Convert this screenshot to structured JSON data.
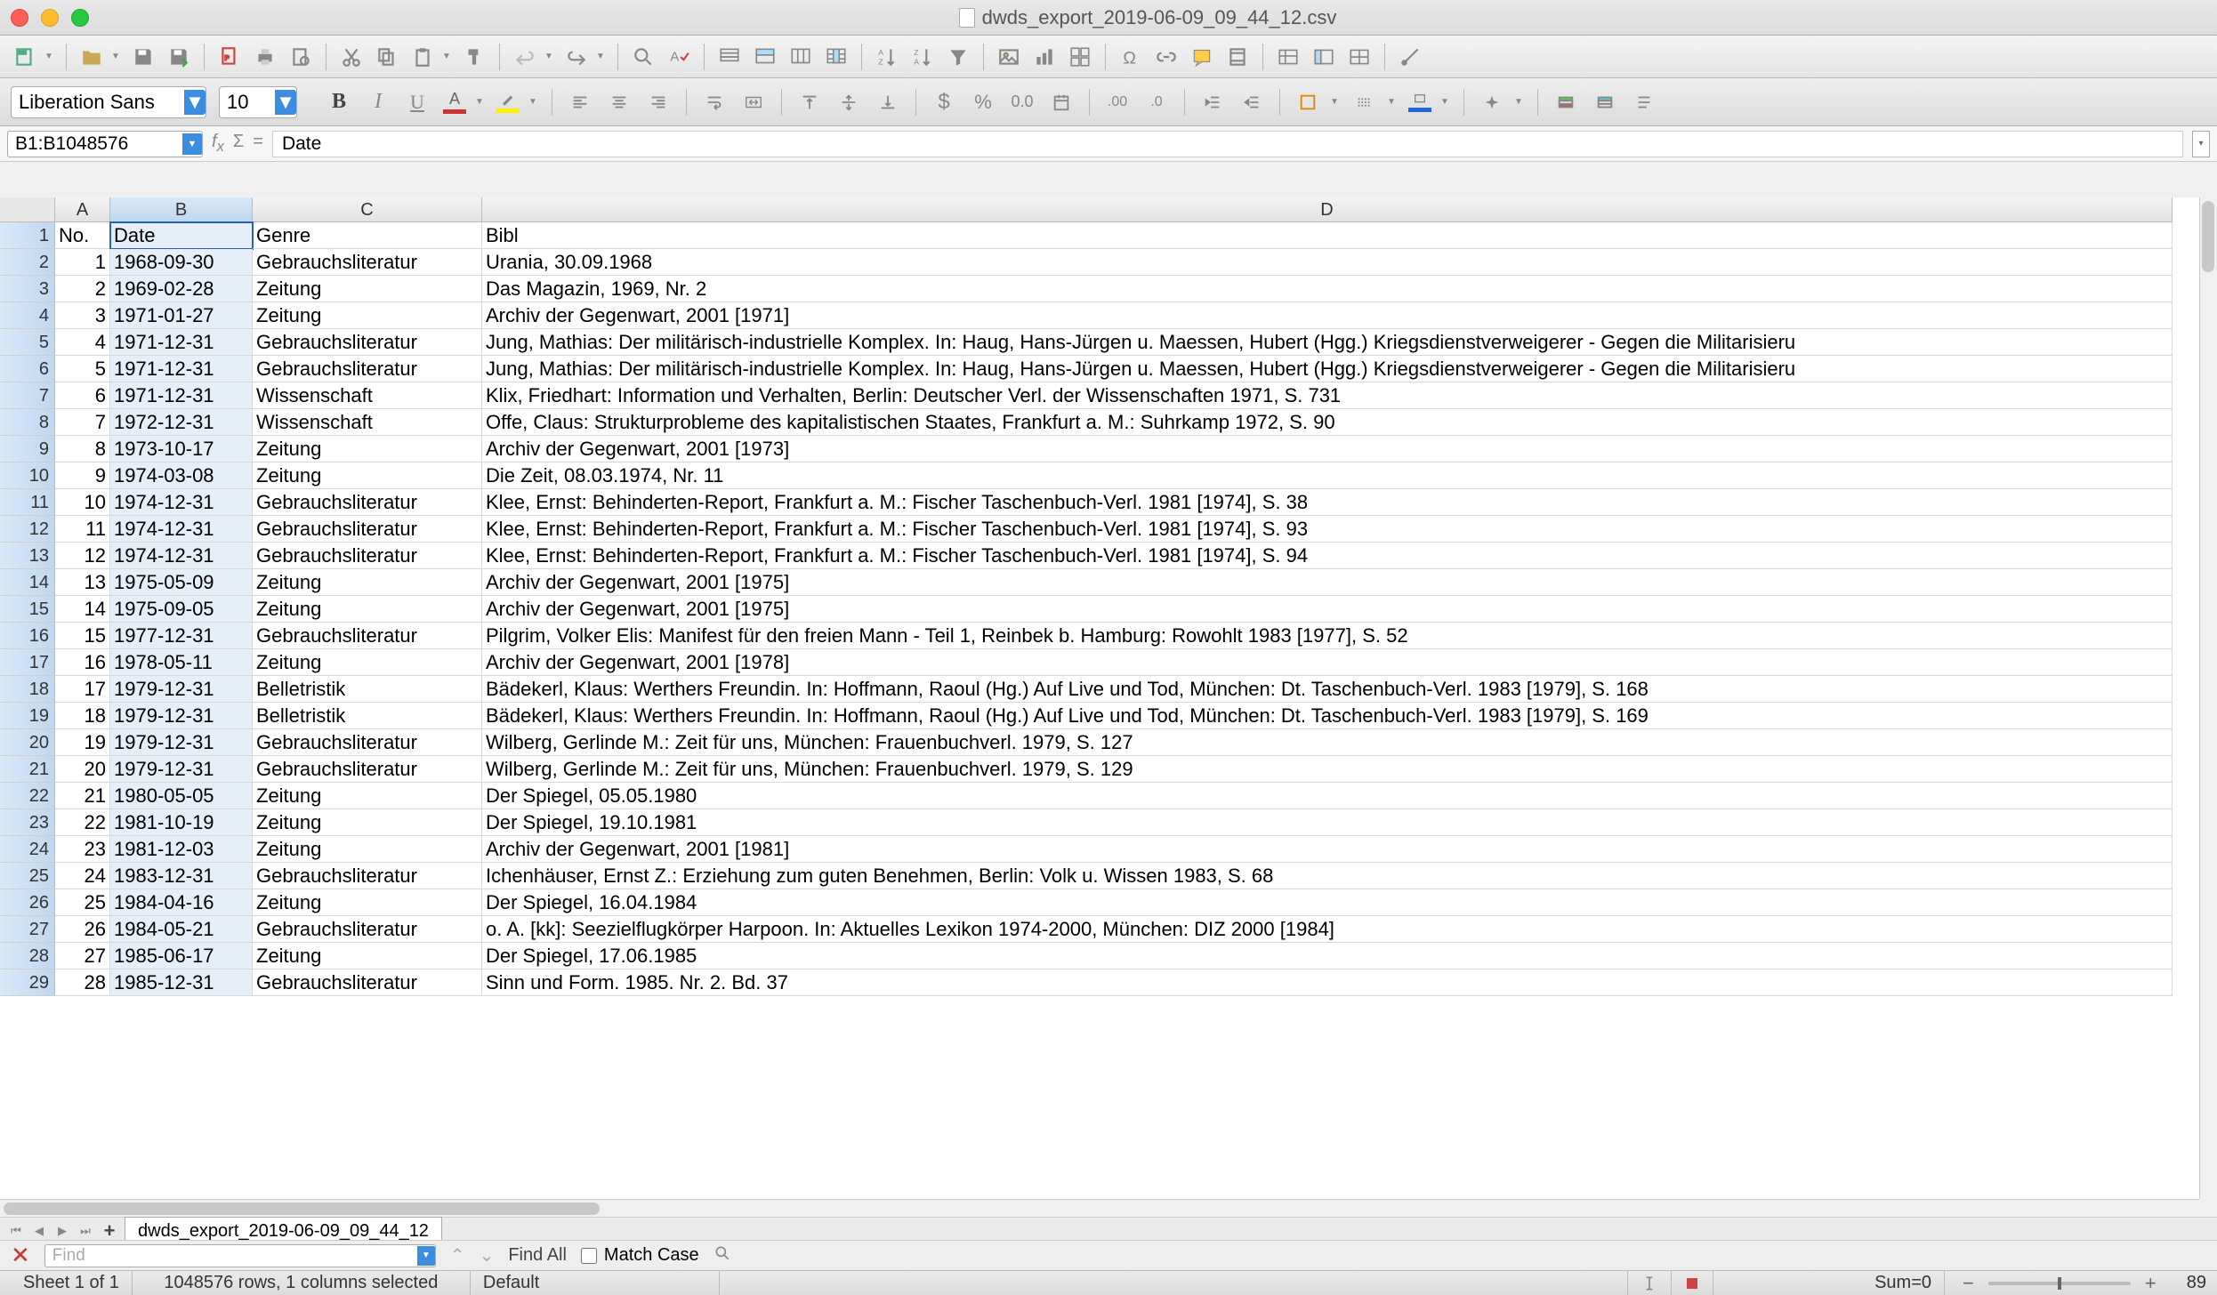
{
  "window": {
    "title": "dwds_export_2019-06-09_09_44_12.csv"
  },
  "font": {
    "name": "Liberation Sans",
    "size": "10"
  },
  "name_box": "B1:B1048576",
  "formula_value": "Date",
  "columns": [
    "A",
    "B",
    "C",
    "D"
  ],
  "headers": {
    "A": "No.",
    "B": "Date",
    "C": "Genre",
    "D": "Bibl"
  },
  "rows": [
    {
      "n": 1,
      "A": "1",
      "B": "1968-09-30",
      "C": "Gebrauchsliteratur",
      "D": "Urania, 30.09.1968"
    },
    {
      "n": 2,
      "A": "2",
      "B": "1969-02-28",
      "C": "Zeitung",
      "D": "Das Magazin, 1969, Nr. 2"
    },
    {
      "n": 3,
      "A": "3",
      "B": "1971-01-27",
      "C": "Zeitung",
      "D": "Archiv der Gegenwart, 2001 [1971]"
    },
    {
      "n": 4,
      "A": "4",
      "B": "1971-12-31",
      "C": "Gebrauchsliteratur",
      "D": "Jung, Mathias: Der militärisch-industrielle Komplex. In: Haug, Hans-Jürgen u. Maessen, Hubert (Hgg.) Kriegsdienstverweigerer - Gegen die Militarisieru"
    },
    {
      "n": 5,
      "A": "5",
      "B": "1971-12-31",
      "C": "Gebrauchsliteratur",
      "D": "Jung, Mathias: Der militärisch-industrielle Komplex. In: Haug, Hans-Jürgen u. Maessen, Hubert (Hgg.) Kriegsdienstverweigerer - Gegen die Militarisieru"
    },
    {
      "n": 6,
      "A": "6",
      "B": "1971-12-31",
      "C": "Wissenschaft",
      "D": "Klix, Friedhart: Information und Verhalten, Berlin: Deutscher Verl. der Wissenschaften 1971, S. 731"
    },
    {
      "n": 7,
      "A": "7",
      "B": "1972-12-31",
      "C": "Wissenschaft",
      "D": "Offe, Claus: Strukturprobleme des kapitalistischen Staates, Frankfurt a. M.: Suhrkamp 1972, S. 90"
    },
    {
      "n": 8,
      "A": "8",
      "B": "1973-10-17",
      "C": "Zeitung",
      "D": "Archiv der Gegenwart, 2001 [1973]"
    },
    {
      "n": 9,
      "A": "9",
      "B": "1974-03-08",
      "C": "Zeitung",
      "D": "Die Zeit, 08.03.1974, Nr. 11"
    },
    {
      "n": 10,
      "A": "10",
      "B": "1974-12-31",
      "C": "Gebrauchsliteratur",
      "D": "Klee, Ernst: Behinderten-Report, Frankfurt a. M.: Fischer Taschenbuch-Verl. 1981 [1974], S. 38"
    },
    {
      "n": 11,
      "A": "11",
      "B": "1974-12-31",
      "C": "Gebrauchsliteratur",
      "D": "Klee, Ernst: Behinderten-Report, Frankfurt a. M.: Fischer Taschenbuch-Verl. 1981 [1974], S. 93"
    },
    {
      "n": 12,
      "A": "12",
      "B": "1974-12-31",
      "C": "Gebrauchsliteratur",
      "D": "Klee, Ernst: Behinderten-Report, Frankfurt a. M.: Fischer Taschenbuch-Verl. 1981 [1974], S. 94"
    },
    {
      "n": 13,
      "A": "13",
      "B": "1975-05-09",
      "C": "Zeitung",
      "D": "Archiv der Gegenwart, 2001 [1975]"
    },
    {
      "n": 14,
      "A": "14",
      "B": "1975-09-05",
      "C": "Zeitung",
      "D": "Archiv der Gegenwart, 2001 [1975]"
    },
    {
      "n": 15,
      "A": "15",
      "B": "1977-12-31",
      "C": "Gebrauchsliteratur",
      "D": "Pilgrim, Volker Elis: Manifest für den freien Mann - Teil 1, Reinbek b. Hamburg: Rowohlt 1983 [1977], S. 52"
    },
    {
      "n": 16,
      "A": "16",
      "B": "1978-05-11",
      "C": "Zeitung",
      "D": "Archiv der Gegenwart, 2001 [1978]"
    },
    {
      "n": 17,
      "A": "17",
      "B": "1979-12-31",
      "C": "Belletristik",
      "D": "Bädekerl, Klaus: Werthers Freundin. In: Hoffmann, Raoul (Hg.) Auf Live und Tod, München: Dt. Taschenbuch-Verl. 1983 [1979], S. 168"
    },
    {
      "n": 18,
      "A": "18",
      "B": "1979-12-31",
      "C": "Belletristik",
      "D": "Bädekerl, Klaus: Werthers Freundin. In: Hoffmann, Raoul (Hg.) Auf Live und Tod, München: Dt. Taschenbuch-Verl. 1983 [1979], S. 169"
    },
    {
      "n": 19,
      "A": "19",
      "B": "1979-12-31",
      "C": "Gebrauchsliteratur",
      "D": "Wilberg, Gerlinde M.: Zeit für uns, München: Frauenbuchverl. 1979, S. 127"
    },
    {
      "n": 20,
      "A": "20",
      "B": "1979-12-31",
      "C": "Gebrauchsliteratur",
      "D": "Wilberg, Gerlinde M.: Zeit für uns, München: Frauenbuchverl. 1979, S. 129"
    },
    {
      "n": 21,
      "A": "21",
      "B": "1980-05-05",
      "C": "Zeitung",
      "D": "Der Spiegel, 05.05.1980"
    },
    {
      "n": 22,
      "A": "22",
      "B": "1981-10-19",
      "C": "Zeitung",
      "D": "Der Spiegel, 19.10.1981"
    },
    {
      "n": 23,
      "A": "23",
      "B": "1981-12-03",
      "C": "Zeitung",
      "D": "Archiv der Gegenwart, 2001 [1981]"
    },
    {
      "n": 24,
      "A": "24",
      "B": "1983-12-31",
      "C": "Gebrauchsliteratur",
      "D": "Ichenhäuser, Ernst Z.: Erziehung zum guten Benehmen, Berlin: Volk u. Wissen 1983, S. 68"
    },
    {
      "n": 25,
      "A": "25",
      "B": "1984-04-16",
      "C": "Zeitung",
      "D": "Der Spiegel, 16.04.1984"
    },
    {
      "n": 26,
      "A": "26",
      "B": "1984-05-21",
      "C": "Gebrauchsliteratur",
      "D": "o. A. [kk]: Seezielflugkörper Harpoon. In: Aktuelles Lexikon 1974-2000, München: DIZ 2000 [1984]"
    },
    {
      "n": 27,
      "A": "27",
      "B": "1985-06-17",
      "C": "Zeitung",
      "D": "Der Spiegel, 17.06.1985"
    },
    {
      "n": 28,
      "A": "28",
      "B": "1985-12-31",
      "C": "Gebrauchsliteratur",
      "D": "Sinn und Form. 1985. Nr. 2. Bd. 37"
    }
  ],
  "sheet_tab": "dwds_export_2019-06-09_09_44_12",
  "find": {
    "placeholder": "Find",
    "find_all": "Find All",
    "match_case": "Match Case"
  },
  "status": {
    "sheet": "Sheet 1 of 1",
    "selection": "1048576 rows, 1 columns selected",
    "style": "Default",
    "sum": "Sum=0",
    "zoom": "89"
  }
}
